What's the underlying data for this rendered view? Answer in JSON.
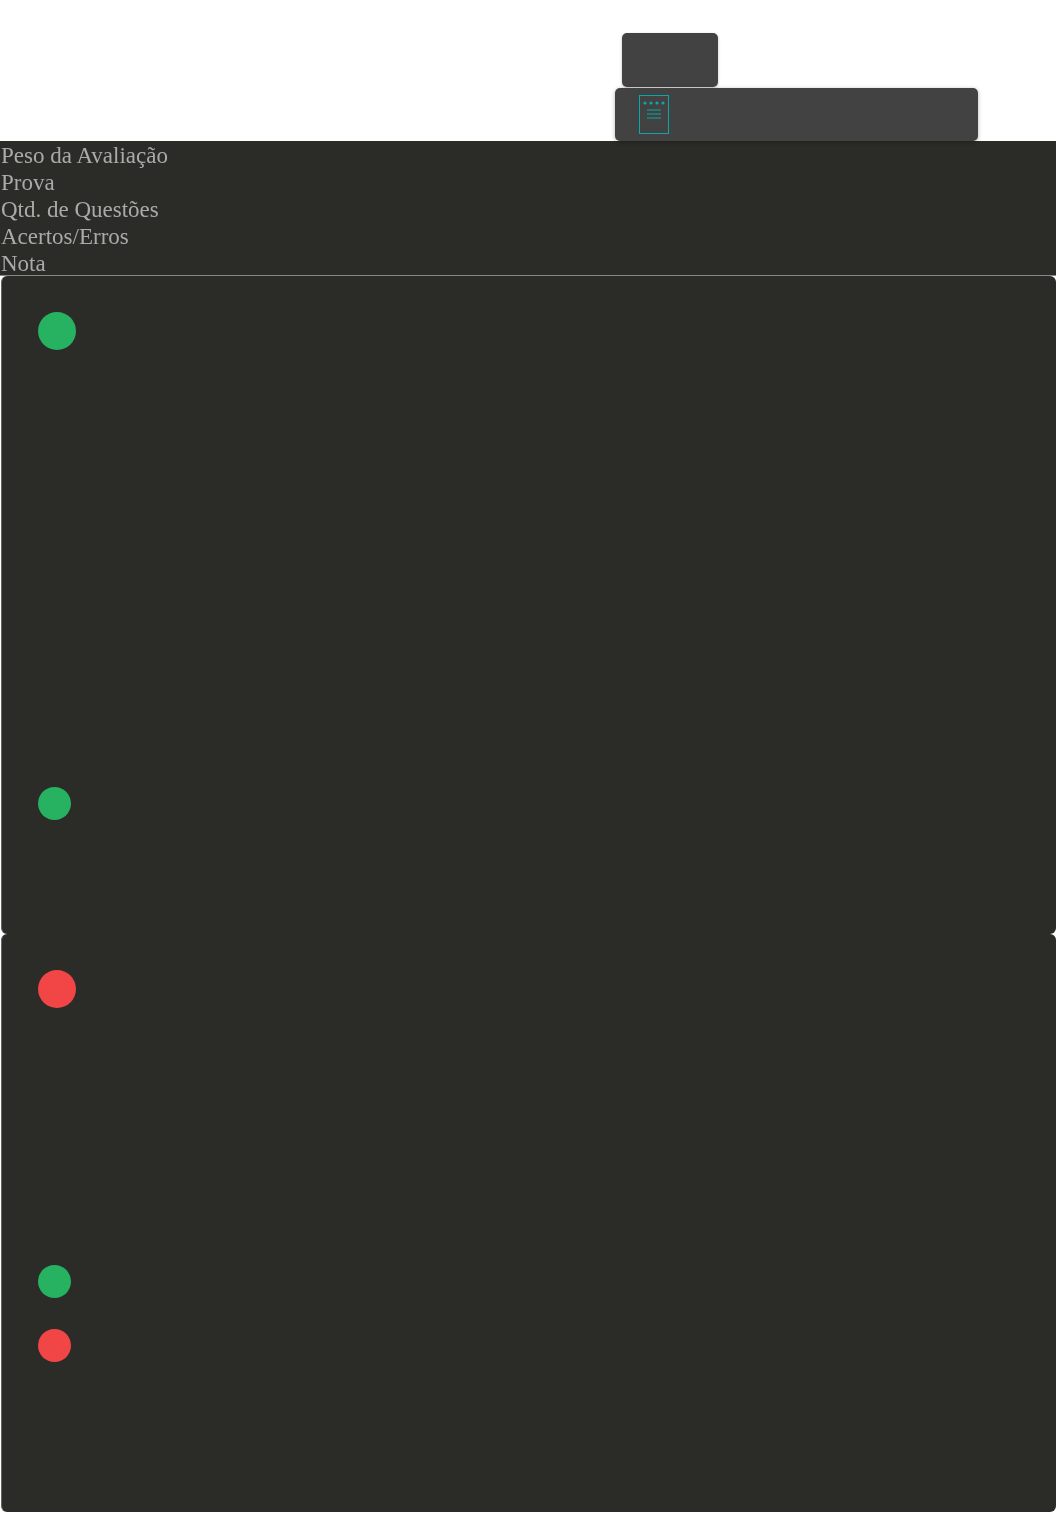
{
  "header": {
    "labels": [
      "Peso da Avaliação",
      "Prova",
      "Qtd. de Questões",
      "Acertos/Erros",
      "Nota"
    ]
  },
  "cards": [
    {
      "markers": [
        {
          "kind": "large",
          "color": "#27b262"
        },
        {
          "kind": "small",
          "color": "#27b262"
        }
      ]
    },
    {
      "markers": [
        {
          "kind": "large",
          "color": "#f24646"
        },
        {
          "kind": "small",
          "color": "#27b262"
        },
        {
          "kind": "small",
          "color": "#f24646"
        }
      ]
    }
  ]
}
